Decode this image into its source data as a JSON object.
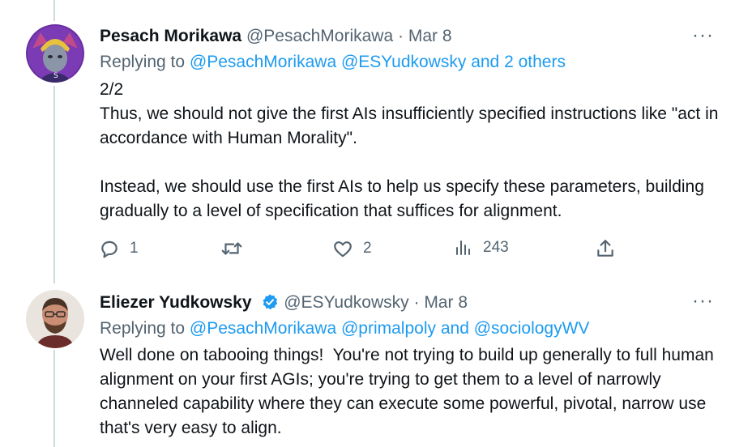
{
  "tweets": [
    {
      "author_name": "Pesach Morikawa",
      "handle": "@PesachMorikawa",
      "date": "Mar 8",
      "replying_prefix": "Replying to",
      "replying_to": [
        "@PesachMorikawa",
        "@ESYudkowsky"
      ],
      "replying_joiner": "and",
      "replying_others": "2 others",
      "paragraphs": [
        "2/2\nThus, we should not give the first AIs insufficiently specified instructions like \"act in accordance with Human Morality\".",
        "Instead, we should use the first AIs to help us specify these parameters, building gradually to a level of specification that suffices for alignment."
      ],
      "actions": {
        "reply_count": "1",
        "retweet_count": "",
        "like_count": "2",
        "view_count": "243"
      }
    },
    {
      "author_name": "Eliezer Yudkowsky",
      "verified": true,
      "handle": "@ESYudkowsky",
      "date": "Mar 8",
      "replying_prefix": "Replying to",
      "replying_to": [
        "@PesachMorikawa",
        "@primalpoly"
      ],
      "replying_joiner": "and",
      "replying_last": "@sociologyWV",
      "paragraphs": [
        "Well done on tabooing things!  You're not trying to build up generally to full human alignment on your first AGIs; you're trying to get them to a level of narrowly channeled capability where they can execute some powerful, pivotal, narrow use that's very easy to align."
      ]
    }
  ],
  "ui": {
    "more_glyph": "···",
    "separator": "·",
    "icons": [
      "reply-icon",
      "retweet-icon",
      "like-icon",
      "views-icon",
      "share-icon",
      "more-icon",
      "verified-icon"
    ],
    "colors": {
      "link": "#1d9bf0",
      "muted": "#536471",
      "text": "#0f1419",
      "thread_line": "#cfd9de"
    }
  }
}
